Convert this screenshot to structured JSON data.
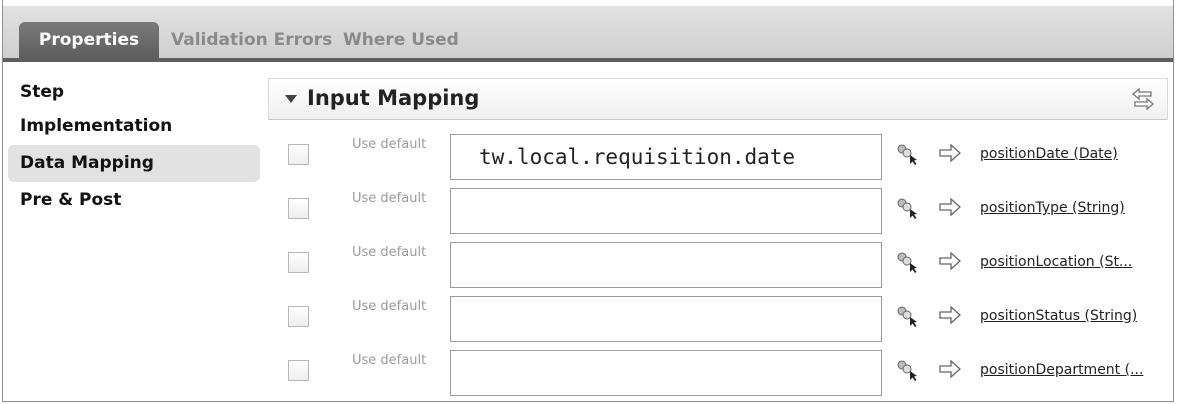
{
  "tabs": [
    {
      "label": "Properties"
    },
    {
      "label": "Validation Errors"
    },
    {
      "label": "Where Used"
    }
  ],
  "sidebar": {
    "items": [
      {
        "label": "Step"
      },
      {
        "label": "Implementation"
      },
      {
        "label": "Data Mapping"
      },
      {
        "label": "Pre & Post"
      }
    ],
    "selected": "Data Mapping"
  },
  "section": {
    "title": "Input Mapping",
    "expanded": true
  },
  "mappings": [
    {
      "use_default_label": "Use default",
      "checked": false,
      "expression": "tw.local.requisition.date",
      "target": "positionDate (Date)"
    },
    {
      "use_default_label": "Use default",
      "checked": false,
      "expression": "",
      "target": "positionType (String)"
    },
    {
      "use_default_label": "Use default",
      "checked": false,
      "expression": "",
      "target": "positionLocation (St..."
    },
    {
      "use_default_label": "Use default",
      "checked": false,
      "expression": "",
      "target": "positionStatus (String)"
    },
    {
      "use_default_label": "Use default",
      "checked": false,
      "expression": "",
      "target": "positionDepartment (..."
    }
  ],
  "icons": {
    "collapse": "chevron-down-icon",
    "sync": "sync-arrows-icon",
    "picker": "variable-picker-icon",
    "map_arrow": "arrow-right-icon"
  }
}
